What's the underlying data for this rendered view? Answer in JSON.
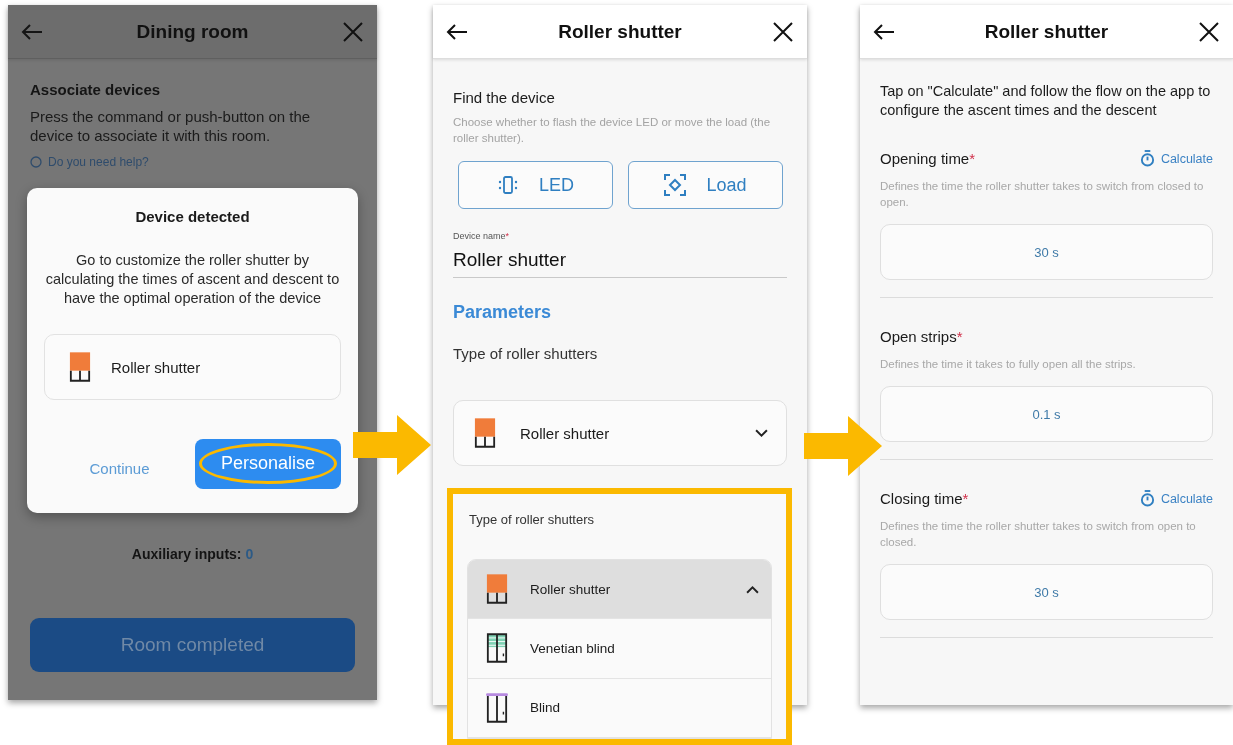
{
  "screens": [
    {
      "kind": "room",
      "title": "Dining room",
      "heading": "Associate devices",
      "text": "Press the command or push-button on the device to associate it with this room.",
      "help_link": "Do you need help?",
      "aux_label": "Auxiliary inputs:",
      "aux_value": "0",
      "primary_button": "Room completed",
      "dialog": {
        "title": "Device detected",
        "message": "Go to customize the roller shutter by calculating the times of ascent and descent to have the optimal operation of the device",
        "device": {
          "name": "Roller shutter",
          "kind": "roller"
        },
        "buttons": [
          {
            "label": "Continue",
            "kind": "text",
            "highlighted": false
          },
          {
            "label": "Personalise",
            "kind": "filled",
            "highlighted": true
          }
        ]
      }
    },
    {
      "kind": "device",
      "title": "Roller shutter",
      "find_heading": "Find the device",
      "find_hint": "Choose whether to flash the device LED or move the load (the roller shutter).",
      "find_buttons": [
        {
          "label": "LED",
          "kind": "led"
        },
        {
          "label": "Load",
          "kind": "load"
        }
      ],
      "name_field": {
        "label": "Device name",
        "mark": "*",
        "value": "Roller shutter"
      },
      "section": "Parameters",
      "type_label": "Type of roller shutters",
      "select": {
        "value": "Roller shutter",
        "kind": "roller",
        "expanded": false
      },
      "callout": {
        "label": "Type of roller shutters",
        "expanded": true,
        "options": [
          {
            "label": "Roller shutter",
            "kind": "roller",
            "selected": true
          },
          {
            "label": "Venetian blind",
            "kind": "venetian",
            "selected": false
          },
          {
            "label": "Blind",
            "kind": "blind",
            "selected": false
          }
        ]
      }
    },
    {
      "kind": "times",
      "title": "Roller shutter",
      "intro": "Tap on \"Calculate\" and follow the flow on the app to configure the ascent times and the descent",
      "params": [
        {
          "label": "Opening time",
          "mark": "*",
          "action": "Calculate",
          "description": "Defines the time the roller shutter takes to switch from closed to open.",
          "value": "30 s"
        },
        {
          "label": "Open strips",
          "mark": "*",
          "description": "Defines the time it takes to fully open all the strips.",
          "value": "0.1 s"
        },
        {
          "label": "Closing time",
          "mark": "*",
          "action": "Calculate",
          "description": "Defines the time the roller shutter takes to switch from open to closed.",
          "value": "30 s"
        }
      ]
    }
  ]
}
